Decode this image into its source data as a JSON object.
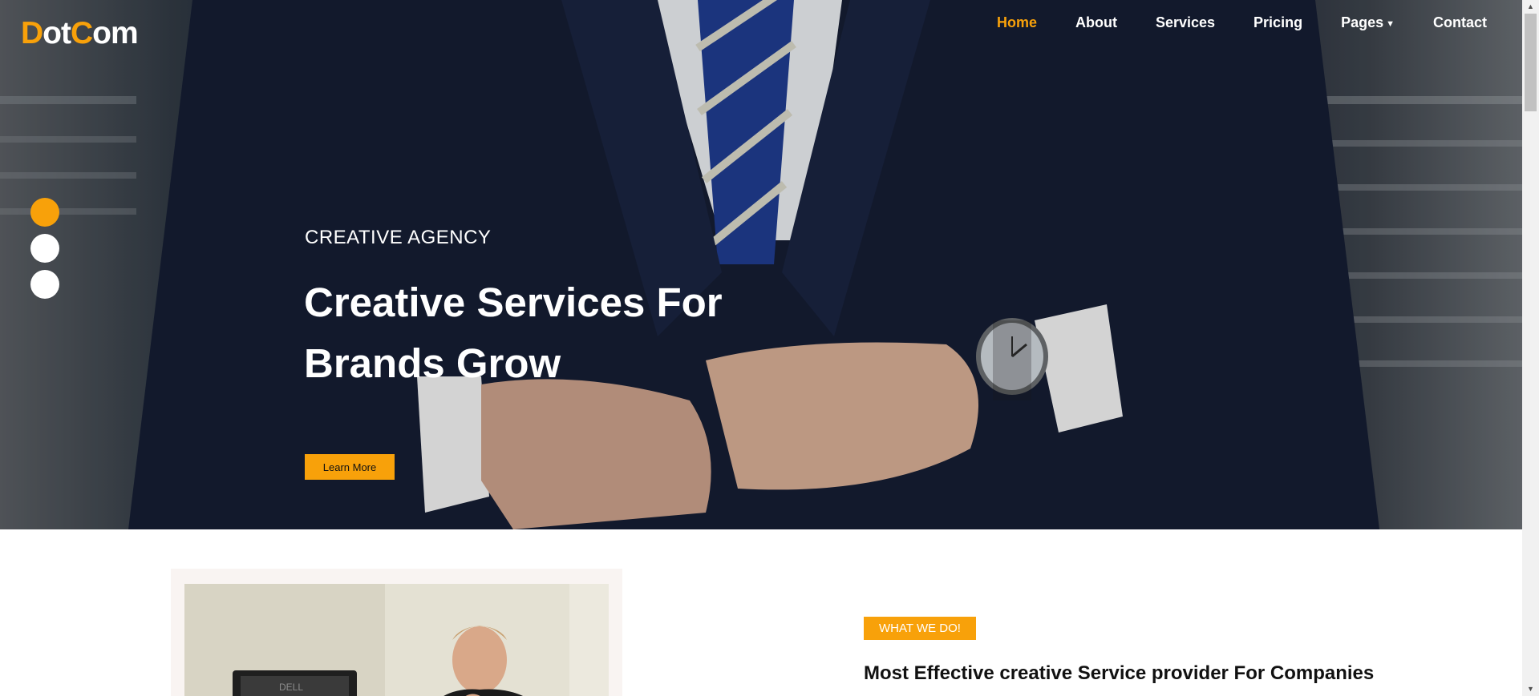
{
  "header": {
    "brand": {
      "d": "D",
      "ot": "ot",
      "c": "C",
      "om": "om"
    },
    "nav": [
      {
        "label": "Home",
        "active": true
      },
      {
        "label": "About"
      },
      {
        "label": "Services"
      },
      {
        "label": "Pricing"
      },
      {
        "label": "Pages",
        "has_dropdown": true
      },
      {
        "label": "Contact"
      }
    ]
  },
  "hero": {
    "eyebrow": "CREATIVE AGENCY",
    "title": "Creative Services For Brands Grow",
    "cta_label": "Learn More",
    "slides_count": 3,
    "active_slide": 1
  },
  "about": {
    "tag": "WHAT WE DO!",
    "title": "Most Effective creative Service provider For Companies"
  },
  "colors": {
    "accent": "#f8a10a",
    "text_dark": "#111111",
    "white": "#ffffff"
  },
  "icons": {
    "dropdown": "caret-down-icon",
    "scroll_up": "arrow-up-icon",
    "scroll_down": "arrow-down-icon"
  }
}
